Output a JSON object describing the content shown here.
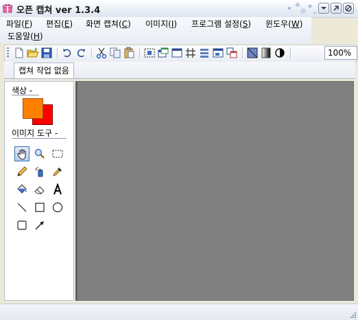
{
  "window": {
    "title": "오픈 캡쳐 ver 1.3.4",
    "app_icon": "gift-icon",
    "controls": [
      "minimize-icon",
      "restore-icon",
      "close-icon"
    ]
  },
  "menu": {
    "items": [
      {
        "label": "파일(",
        "key": "F",
        "end": ")"
      },
      {
        "label": "편집(",
        "key": "E",
        "end": ")"
      },
      {
        "label": "화면 캡쳐(",
        "key": "C",
        "end": ")"
      },
      {
        "label": "이미지(",
        "key": "I",
        "end": ")"
      },
      {
        "label": "프로그램 설정(",
        "key": "S",
        "end": ")"
      },
      {
        "label": "윈도우(",
        "key": "W",
        "end": ")"
      },
      {
        "label": "도움말(",
        "key": "H",
        "end": ")"
      }
    ]
  },
  "toolbar": {
    "buttons": [
      "new-file-icon",
      "open-folder-icon",
      "save-icon",
      "undo-icon",
      "redo-icon",
      "cut-icon",
      "copy-icon",
      "paste-icon",
      "region-capture-icon",
      "window-capture-icon",
      "fullscreen-capture-icon",
      "fixed-size-capture-icon",
      "scroll-capture-icon",
      "multi-capture-icon",
      "shade-icon",
      "gradient-icon",
      "contrast-icon"
    ],
    "zoom_value": "100%"
  },
  "tabs": {
    "items": [
      {
        "label": "캡쳐 작업 없음"
      }
    ]
  },
  "left_panel": {
    "color_label": "색상 -",
    "foreground_color": "#FF8000",
    "background_color": "#FF0000",
    "tools_label": "이미지 도구 -",
    "tools": [
      "hand-icon",
      "magnifier-icon",
      "rect-select-icon",
      "pencil-icon",
      "spray-icon",
      "eyedropper-icon",
      "fill-bucket-icon",
      "eraser-icon",
      "text-icon",
      "line-icon",
      "rectangle-icon",
      "ellipse-icon",
      "rounded-rect-icon",
      "arrow-icon"
    ],
    "active_tool": "hand-icon"
  },
  "canvas": {
    "background": "#808080"
  }
}
